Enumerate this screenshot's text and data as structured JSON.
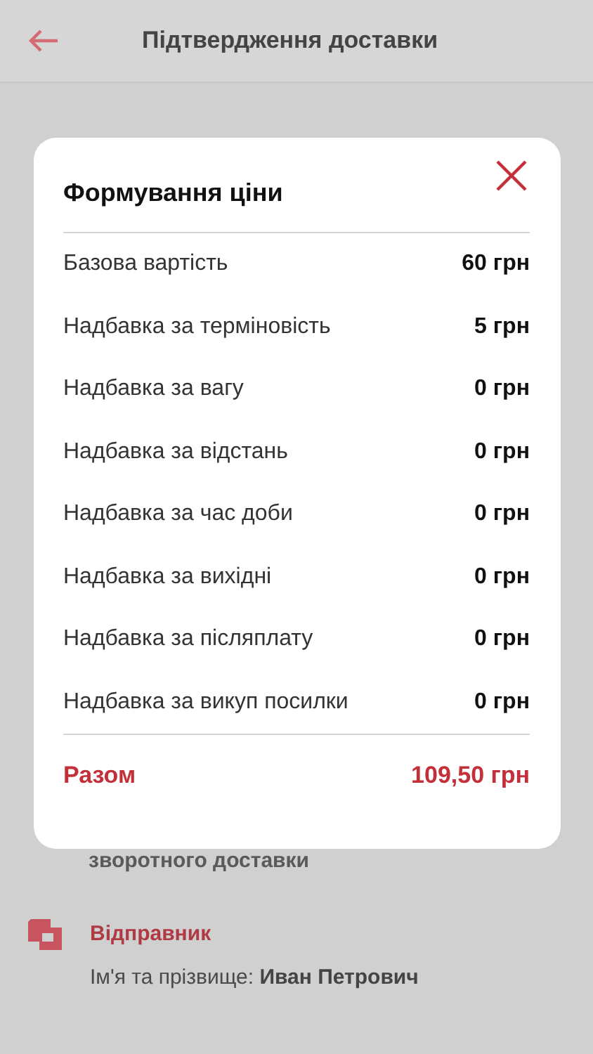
{
  "header": {
    "title": "Підтвердження доставки"
  },
  "background": {
    "text_1": "зворотного доставки",
    "sender_title": "Відправник",
    "sender_label": "Ім'я та прізвище:",
    "sender_name": "Иван Петрович"
  },
  "dialog": {
    "title": "Формування ціни",
    "rows": [
      {
        "label": "Базова вартість",
        "value": "60 грн"
      },
      {
        "label": "Надбавка за терміновість",
        "value": "5 грн"
      },
      {
        "label": "Надбавка за вагу",
        "value": "0 грн"
      },
      {
        "label": "Надбавка за відстань",
        "value": "0 грн"
      },
      {
        "label": "Надбавка за час доби",
        "value": "0 грн"
      },
      {
        "label": "Надбавка за вихідні",
        "value": "0 грн"
      },
      {
        "label": "Надбавка за післяплату",
        "value": "0 грн"
      },
      {
        "label": "Надбавка за викуп посилки",
        "value": "0 грн"
      }
    ],
    "total": {
      "label": "Разом",
      "value": "109,50 грн"
    }
  }
}
